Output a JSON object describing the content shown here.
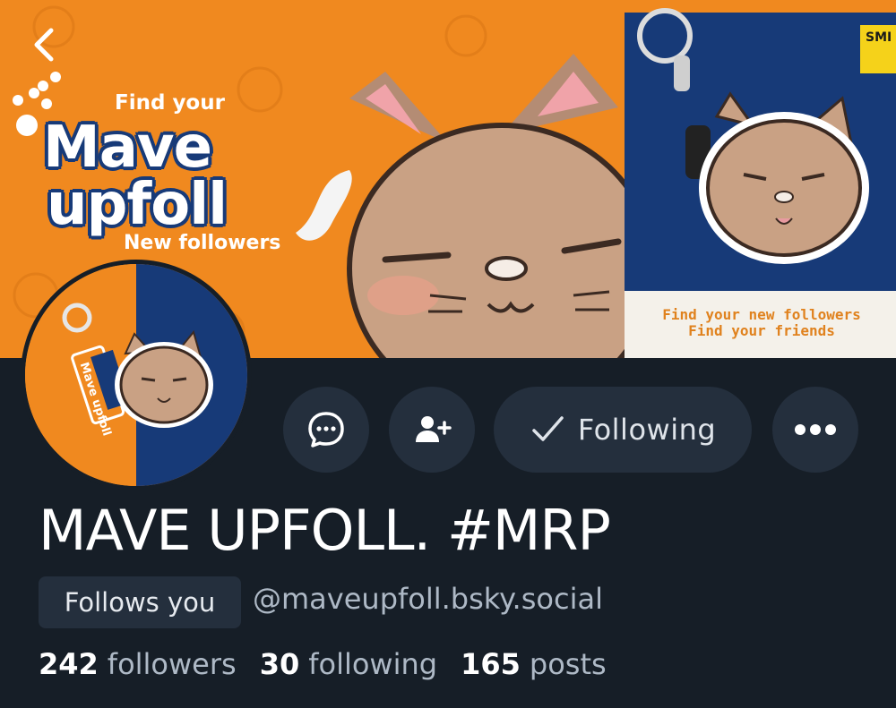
{
  "banner": {
    "find_your": "Find your",
    "brand_line1": "Mave",
    "brand_line2": "upfoll",
    "new_followers": "New followers",
    "poster_line1": "Find your new followers",
    "poster_line2": "Find your friends",
    "poster_badge": "SMI"
  },
  "avatar": {
    "tag_text": "Mave upfoll"
  },
  "actions": {
    "following_label": "Following"
  },
  "profile": {
    "display_name": "MAVE UPFOLL. #MRP",
    "follows_you": "Follows you",
    "handle": "@maveupfoll.bsky.social"
  },
  "stats": {
    "followers_count": "242",
    "followers_label": "followers",
    "following_count": "30",
    "following_label": "following",
    "posts_count": "165",
    "posts_label": "posts"
  },
  "colors": {
    "background": "#161e27",
    "button_bg": "#242f3d",
    "banner_orange": "#f0891f",
    "banner_navy": "#173a78",
    "muted_text": "#aeb9c6"
  },
  "icons": [
    "back-arrow-icon",
    "message-icon",
    "add-person-icon",
    "check-icon",
    "more-icon"
  ]
}
